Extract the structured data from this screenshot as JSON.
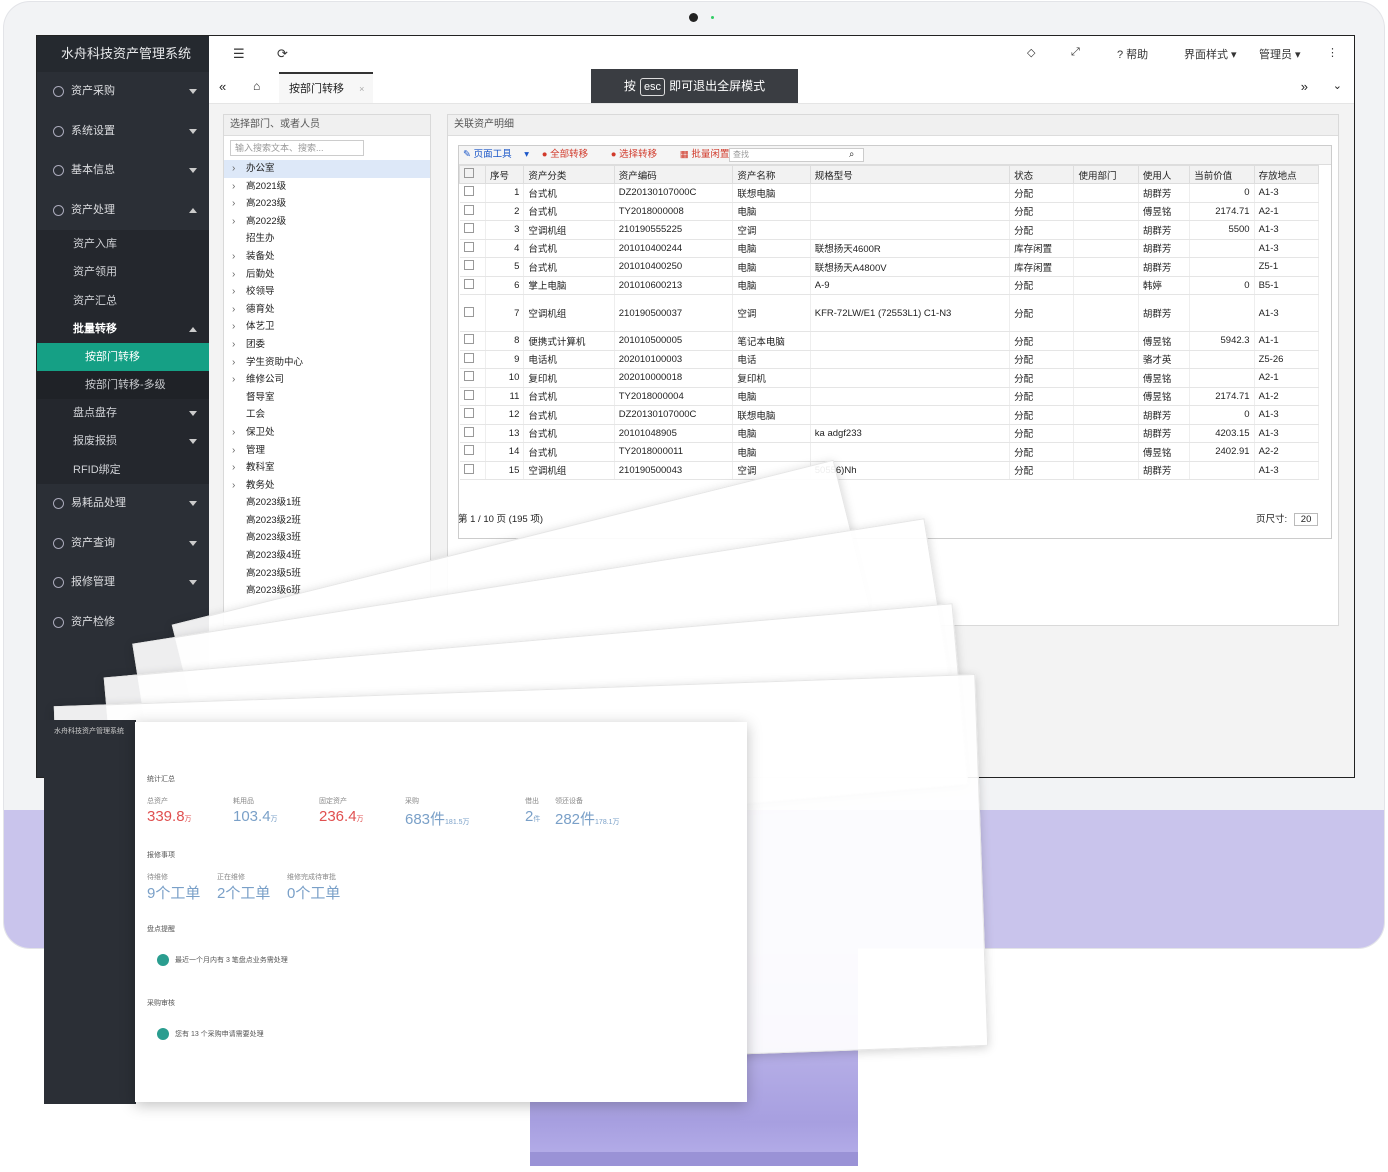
{
  "app": {
    "title": "水舟科技资产管理系统"
  },
  "sidebar": {
    "items": [
      {
        "label": "资产采购"
      },
      {
        "label": "系统设置"
      },
      {
        "label": "基本信息"
      },
      {
        "label": "资产处理"
      }
    ],
    "asset_sub": [
      "资产入库",
      "资产领用",
      "资产汇总",
      "批量转移"
    ],
    "transfer_sub": [
      "按部门转移",
      "按部门转移-多级"
    ],
    "after_items": [
      "盘点盘存",
      "报废报损",
      "RFID绑定"
    ],
    "bottom_items": [
      "易耗品处理",
      "资产查询",
      "报修管理",
      "资产检修"
    ]
  },
  "topbar": {
    "help": "? 帮助",
    "theme": "界面样式",
    "admin": "管理员"
  },
  "tab": {
    "label": "按部门转移"
  },
  "esc_banner": {
    "pre": "按",
    "key": "esc",
    "post": "即可退出全屏模式"
  },
  "left_panel": {
    "title": "选择部门、或者人员",
    "search_placeholder": "输入搜索文本、搜索...",
    "tree": [
      {
        "label": "办公室",
        "arrow": true,
        "sel": true
      },
      {
        "label": "高2021级",
        "arrow": true
      },
      {
        "label": "高2023级",
        "arrow": true
      },
      {
        "label": "高2022级",
        "arrow": true
      },
      {
        "label": "招生办",
        "arrow": false
      },
      {
        "label": "装备处",
        "arrow": true
      },
      {
        "label": "后勤处",
        "arrow": true
      },
      {
        "label": "校领导",
        "arrow": true
      },
      {
        "label": "德育处",
        "arrow": true
      },
      {
        "label": "体艺卫",
        "arrow": true
      },
      {
        "label": "团委",
        "arrow": true
      },
      {
        "label": "学生资助中心",
        "arrow": true
      },
      {
        "label": "维修公司",
        "arrow": true
      },
      {
        "label": "督导室",
        "arrow": false
      },
      {
        "label": "工会",
        "arrow": false
      },
      {
        "label": "保卫处",
        "arrow": true
      },
      {
        "label": "管理",
        "arrow": true
      },
      {
        "label": "教科室",
        "arrow": true
      },
      {
        "label": "教务处",
        "arrow": true
      },
      {
        "label": "高2023级1班",
        "arrow": false
      },
      {
        "label": "高2023级2班",
        "arrow": false
      },
      {
        "label": "高2023级3班",
        "arrow": false
      },
      {
        "label": "高2023级4班",
        "arrow": false
      },
      {
        "label": "高2023级5班",
        "arrow": false
      },
      {
        "label": "高2023级6班",
        "arrow": false
      }
    ]
  },
  "right_panel": {
    "title": "关联资产明细",
    "toolbar": {
      "page_tools": "页面工具",
      "all_transfer": "全部转移",
      "select_transfer": "选择转移",
      "batch_idle": "批量闲置",
      "search_placeholder": "查找"
    },
    "columns": [
      "序号",
      "资产分类",
      "资产编码",
      "资产名称",
      "规格型号",
      "状态",
      "使用部门",
      "使用人",
      "当前价值",
      "存放地点"
    ],
    "rows": [
      [
        "1",
        "台式机",
        "DZ20130107000C",
        "联想电脑",
        "",
        "分配",
        "",
        "胡群芳",
        "0",
        "A1-3"
      ],
      [
        "2",
        "台式机",
        "TY2018000008",
        "电脑",
        "",
        "分配",
        "",
        "傅昱铭",
        "2174.71",
        "A2-1"
      ],
      [
        "3",
        "空调机组",
        "210190555225",
        "空调",
        "",
        "分配",
        "",
        "胡群芳",
        "5500",
        "A1-3"
      ],
      [
        "4",
        "台式机",
        "201010400244",
        "电脑",
        "联想扬天4600R",
        "库存闲置",
        "",
        "胡群芳",
        "",
        "A1-3"
      ],
      [
        "5",
        "台式机",
        "201010400250",
        "电脑",
        "联想扬天A4800V",
        "库存闲置",
        "",
        "胡群芳",
        "",
        "Z5-1"
      ],
      [
        "6",
        "掌上电脑",
        "201010600213",
        "电脑",
        "A-9",
        "分配",
        "",
        "韩婷",
        "0",
        "B5-1"
      ],
      [
        "7",
        "空调机组",
        "210190500037",
        "空调",
        "KFR-72LW/E1 (72553L1) C1-N3",
        "分配",
        "",
        "胡群芳",
        "",
        "A1-3"
      ],
      [
        "8",
        "便携式计算机",
        "201010500005",
        "笔记本电脑",
        "",
        "分配",
        "",
        "傅昱铭",
        "5942.3",
        "A1-1"
      ],
      [
        "9",
        "电话机",
        "202010100003",
        "电话",
        "",
        "分配",
        "",
        "骆才英",
        "",
        "Z5-26"
      ],
      [
        "10",
        "复印机",
        "202010000018",
        "复印机",
        "",
        "分配",
        "",
        "傅昱铭",
        "",
        "A2-1"
      ],
      [
        "11",
        "台式机",
        "TY2018000004",
        "电脑",
        "",
        "分配",
        "",
        "傅昱铭",
        "2174.71",
        "A1-2"
      ],
      [
        "12",
        "台式机",
        "DZ20130107000C",
        "联想电脑",
        "",
        "分配",
        "",
        "胡群芳",
        "0",
        "A1-3"
      ],
      [
        "13",
        "台式机",
        "20101048905",
        "电脑",
        "ka adgf233",
        "分配",
        "",
        "胡群芳",
        "4203.15",
        "A1-3"
      ],
      [
        "14",
        "台式机",
        "TY2018000011",
        "电脑",
        "",
        "分配",
        "",
        "傅昱铭",
        "2402.91",
        "A2-2"
      ],
      [
        "15",
        "空调机组",
        "210190500043",
        "空调",
        "50556)Nh",
        "分配",
        "",
        "胡群芳",
        "",
        "A1-3"
      ]
    ],
    "pager": "第 1 / 10 页 (195 项)",
    "page_size_label": "页尺寸:",
    "page_size": "20"
  },
  "dashboard": {
    "sec1": "统计汇总",
    "stats": [
      {
        "label": "总资产",
        "value": "339.8",
        "unit": "万"
      },
      {
        "label": "耗用品",
        "value": "103.4",
        "unit": "万"
      },
      {
        "label": "固定资产",
        "value": "236.4",
        "unit": "万"
      },
      {
        "label": "采购",
        "value": "683件",
        "unit": "181.5万"
      },
      {
        "label": "借出",
        "value": "2",
        "unit": "件"
      },
      {
        "label": "领还设备",
        "value": "282件",
        "unit": "178.1万"
      }
    ],
    "sec2": "报修事项",
    "repairs": [
      {
        "label": "待维修",
        "value": "9个工单"
      },
      {
        "label": "正在维修",
        "value": "2个工单"
      },
      {
        "label": "维修完成待审批",
        "value": "0个工单"
      }
    ],
    "sec3": "盘点提醒",
    "notice1": "最近一个月内有 3 笔盘点业务需处理",
    "sec4": "采购审核",
    "notice2": "您有 13 个采购申请需要处理"
  }
}
